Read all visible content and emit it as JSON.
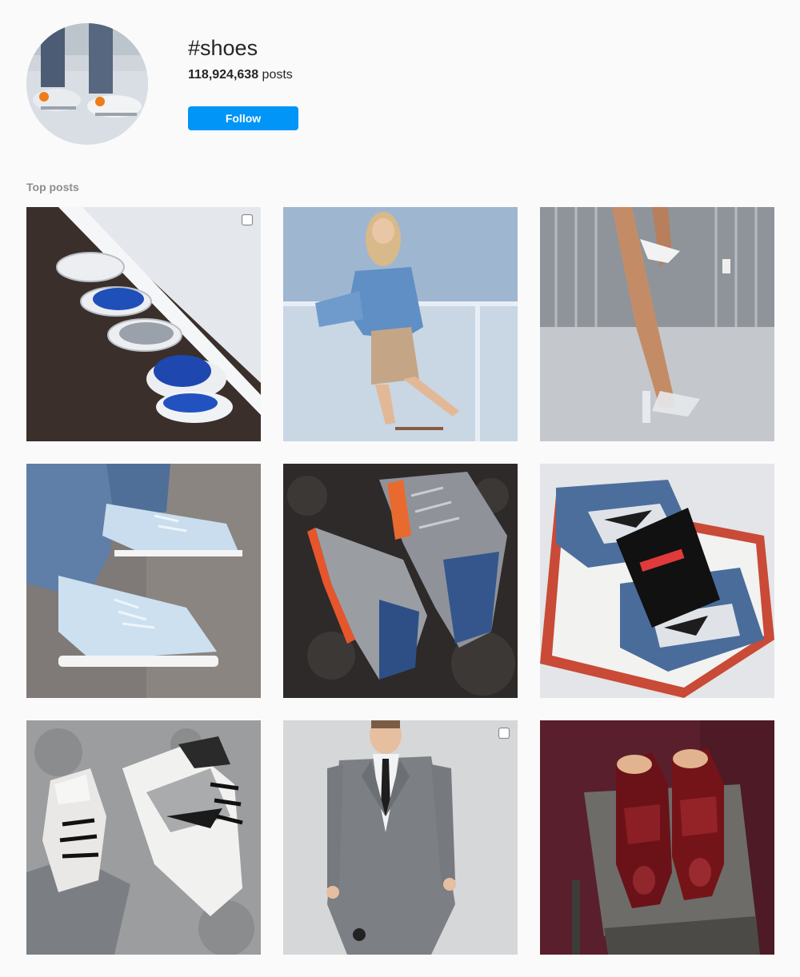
{
  "hashtag": {
    "title": "#shoes",
    "post_count": "118,924,638",
    "post_count_suffix": " posts",
    "follow_label": "Follow"
  },
  "section": {
    "label": "Top posts"
  },
  "posts": [
    {
      "name": "post-sneakers-row",
      "multi": true
    },
    {
      "name": "post-denim-jacket-woman",
      "multi": false
    },
    {
      "name": "post-clear-heels",
      "multi": false
    },
    {
      "name": "post-light-blue-yeezy",
      "multi": false
    },
    {
      "name": "post-grey-blue-runners",
      "multi": false
    },
    {
      "name": "post-fear-jordans-box",
      "multi": false
    },
    {
      "name": "post-grey-white-jordans",
      "multi": false
    },
    {
      "name": "post-grey-suit-man",
      "multi": true
    },
    {
      "name": "post-burgundy-oxfords",
      "multi": false
    }
  ],
  "colors": {
    "accent": "#0095f6",
    "background": "#fafafa",
    "muted_text": "#8e8e8e"
  }
}
